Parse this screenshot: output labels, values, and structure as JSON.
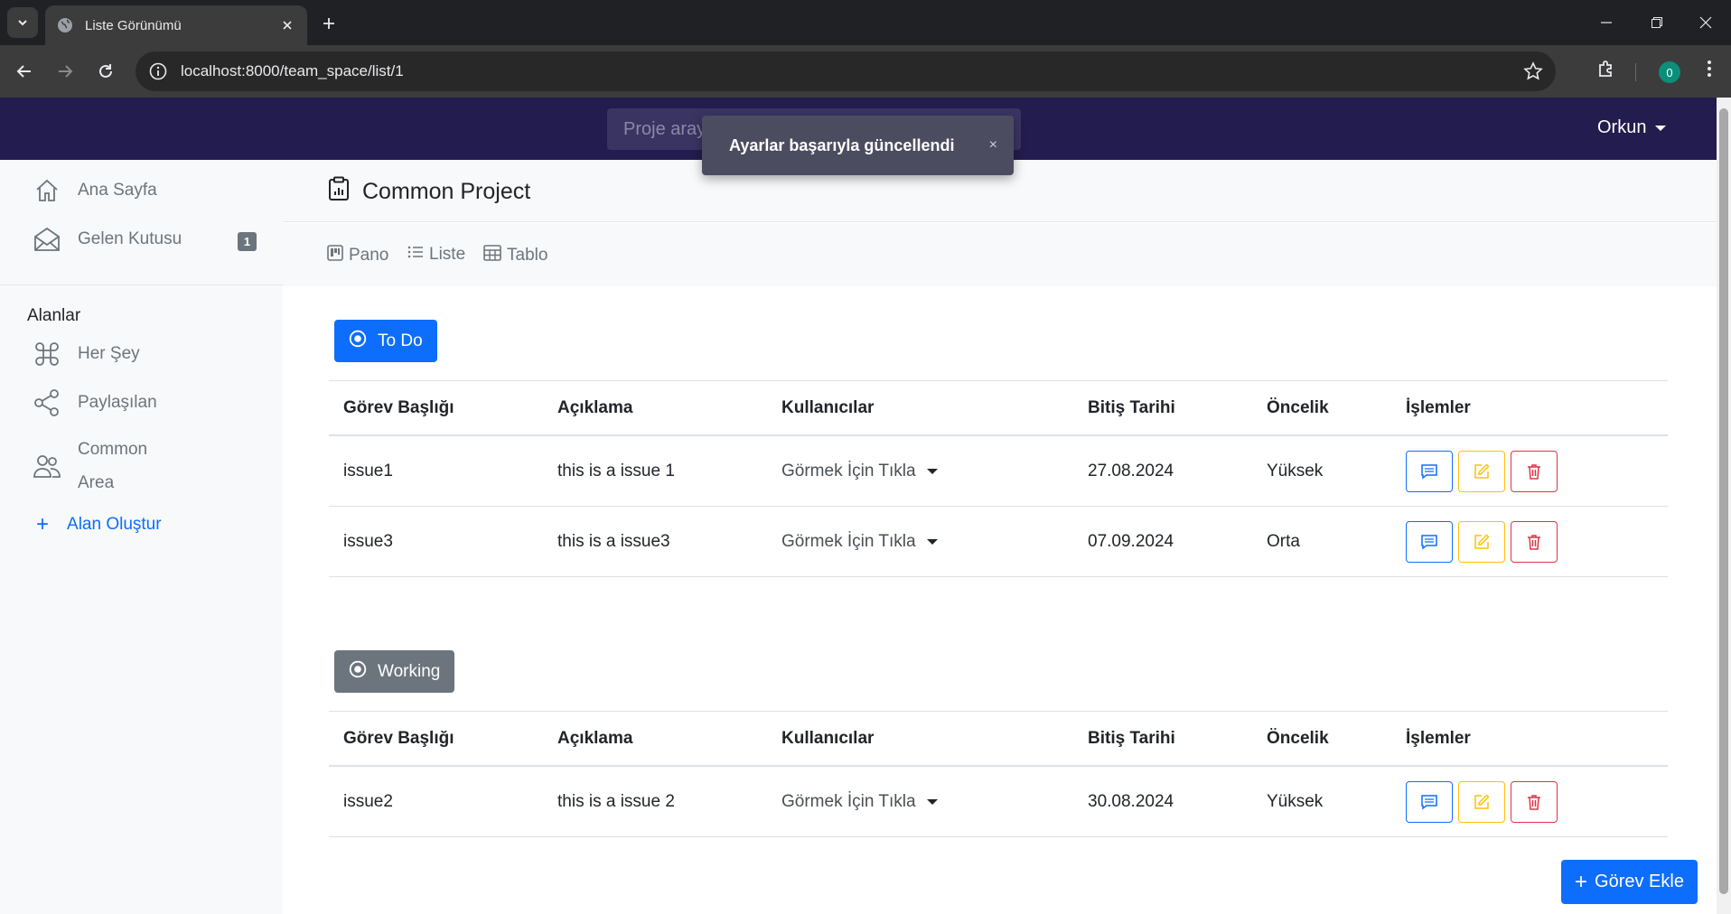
{
  "browser": {
    "tab_title": "Liste Görünümü",
    "url": "localhost:8000/team_space/list/1",
    "profile_initial": "0"
  },
  "header": {
    "search_placeholder": "Proje aray",
    "user_name": "Orkun"
  },
  "toast": {
    "message": "Ayarlar başarıyla güncellendi",
    "close": "×"
  },
  "sidebar": {
    "home": "Ana Sayfa",
    "inbox": "Gelen Kutusu",
    "inbox_badge": "1",
    "spaces_heading": "Alanlar",
    "items": [
      {
        "label": "Her Şey",
        "icon": "command-icon"
      },
      {
        "label": "Paylaşılan",
        "icon": "share-icon"
      },
      {
        "label_line1": "Common",
        "label_line2": "Area",
        "icon": "people-icon"
      }
    ],
    "create_area": "Alan Oluştur",
    "create_icon": "+"
  },
  "project": {
    "title": "Common Project",
    "views": [
      "Pano",
      "Liste",
      "Tablo"
    ]
  },
  "columns": [
    "Görev Başlığı",
    "Açıklama",
    "Kullanıcılar",
    "Bitiş Tarihi",
    "Öncelik",
    "İşlemler"
  ],
  "groups": [
    {
      "status": "To Do",
      "color": "#0d6efd",
      "rows": [
        {
          "title": "issue1",
          "description": "this is a issue 1",
          "users": "Görmek İçin Tıkla",
          "due": "27.08.2024",
          "priority": "Yüksek"
        },
        {
          "title": "issue3",
          "description": "this is a issue3",
          "users": "Görmek İçin Tıkla",
          "due": "07.09.2024",
          "priority": "Orta"
        }
      ]
    },
    {
      "status": "Working",
      "color": "#6c757d",
      "rows": [
        {
          "title": "issue2",
          "description": "this is a issue 2",
          "users": "Görmek İçin Tıkla",
          "due": "30.08.2024",
          "priority": "Yüksek"
        }
      ]
    }
  ],
  "add_task": "Görev Ekle",
  "add_icon": "+",
  "colors": {
    "header_bg": "#231c4e",
    "primary": "#0d6efd",
    "secondary": "#6c757d",
    "warning": "#ffc107",
    "danger": "#dc3545"
  }
}
